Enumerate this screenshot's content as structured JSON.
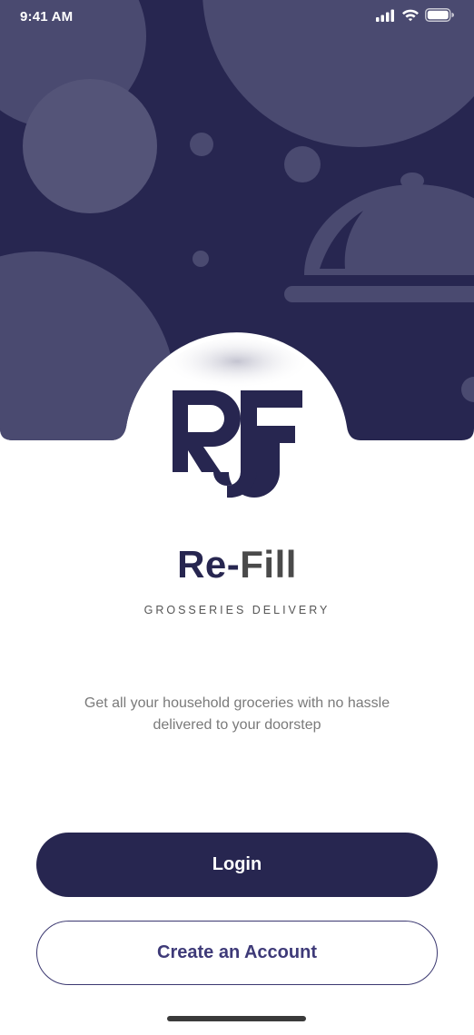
{
  "status_bar": {
    "time": "9:41 AM",
    "icons": [
      "cellular-signal-icon",
      "wifi-icon",
      "battery-icon"
    ]
  },
  "hero": {
    "illustration": "food-cloche-icon",
    "logo_text": "RF"
  },
  "brand": {
    "name_part1": "Re-",
    "name_part2": "Fill",
    "tagline": "GROSSERIES DELIVERY"
  },
  "description": "Get all your household groceries with no hassle delivered to your doorstep",
  "actions": {
    "login_label": "Login",
    "create_account_label": "Create an Account"
  },
  "colors": {
    "primary": "#272650",
    "bubble": "#4a4a70",
    "text_muted": "#7a7a7a"
  }
}
